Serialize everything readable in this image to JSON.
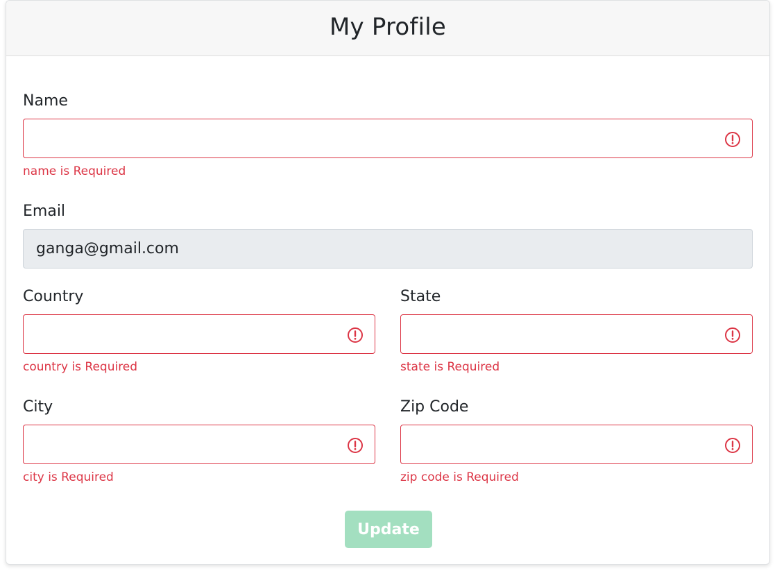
{
  "header": {
    "title": "My Profile"
  },
  "form": {
    "name": {
      "label": "Name",
      "value": "",
      "error": "name is Required"
    },
    "email": {
      "label": "Email",
      "value": "ganga@gmail.com"
    },
    "country": {
      "label": "Country",
      "value": "",
      "error": "country is Required"
    },
    "state": {
      "label": "State",
      "value": "",
      "error": "state is Required"
    },
    "city": {
      "label": "City",
      "value": "",
      "error": "city is Required"
    },
    "zip": {
      "label": "Zip Code",
      "value": "",
      "error": "zip code is Required"
    },
    "submit_label": "Update"
  },
  "icons": {
    "field_error": "exclamation-circle-icon"
  },
  "colors": {
    "error": "#dc3545",
    "button_disabled": "#a3dfc0",
    "readonly_bg": "#e9ecef",
    "header_bg": "#f7f7f7"
  }
}
